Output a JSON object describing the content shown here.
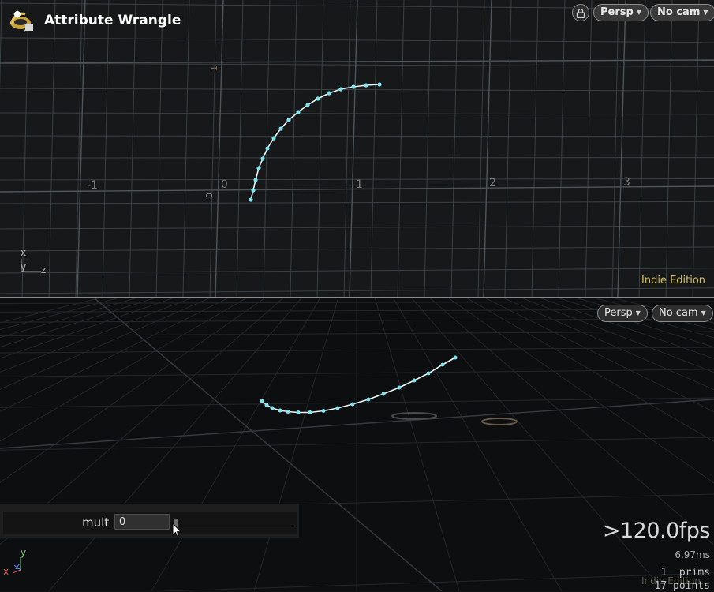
{
  "node": {
    "title": "Attribute Wrangle",
    "icon": "wrangle-node-icon"
  },
  "top_viewport": {
    "camera_mode": "Persp",
    "camera": "No cam",
    "lock_icon": "lock-icon",
    "edition": "Indie Edition",
    "axis_x_ticks": [
      "-1",
      "0",
      "1",
      "2",
      "3"
    ],
    "axis_y_ticks": [
      "1",
      "0"
    ],
    "axis_gizmo": {
      "x": "x",
      "y": "y",
      "z": "z"
    },
    "gizmo_colors": {
      "x": "#b8b8b8",
      "y": "#b8b8b8",
      "z": "#b8b8b8"
    },
    "curve_point_count": 17,
    "curve_color": "#7fe6f0"
  },
  "bottom_viewport": {
    "camera_mode": "Persp",
    "camera": "No cam",
    "axis_gizmo": {
      "x": "x",
      "y": "y",
      "z": "z"
    },
    "gizmo_colors": {
      "x": "#e05050",
      "y": "#7ad07a",
      "z": "#6a8ae0"
    },
    "edition": "Indie Edition"
  },
  "parameter": {
    "label": "mult",
    "value": "0"
  },
  "stats": {
    "fps": ">120.0fps",
    "frame_time": "6.97ms",
    "prims": "1  prims",
    "points": "17 points"
  }
}
